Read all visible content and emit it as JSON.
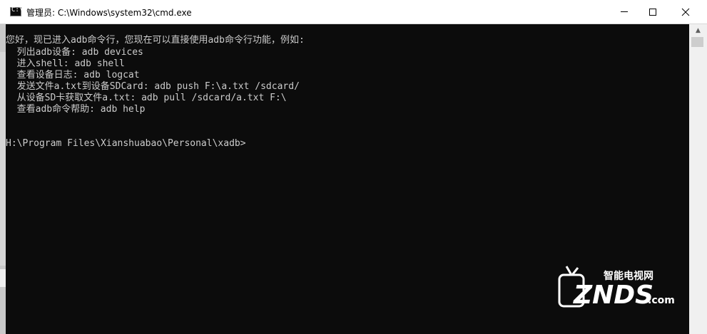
{
  "window": {
    "title": "管理员: C:\\Windows\\system32\\cmd.exe",
    "icon": "cmd-icon",
    "controls": [
      "minimize-icon",
      "maximize-icon",
      "close-icon"
    ]
  },
  "terminal": {
    "background": "#0c0c0c",
    "foreground": "#cccccc",
    "lines": [
      "您好，现已进入adb命令行，您现在可以直接使用adb命令行功能，例如:",
      "  列出adb设备: adb devices",
      "  进入shell: adb shell",
      "  查看设备日志: adb logcat",
      "  发送文件a.txt到设备SDCard: adb push F:\\a.txt /sdcard/",
      "  从设备SD卡获取文件a.txt: adb pull /sdcard/a.txt F:\\",
      "  查看adb命令帮助: adb help",
      "",
      "",
      "H:\\Program Files\\Xianshuabao\\Personal\\xadb>"
    ]
  },
  "watermark": {
    "brand_cn": "智能电视网",
    "brand": "ZNDS",
    "domain": ".com"
  },
  "colors": {
    "titlebar": "#ffffff",
    "scrollbar": "#f0f0f0",
    "watermark": "#ffffff"
  }
}
